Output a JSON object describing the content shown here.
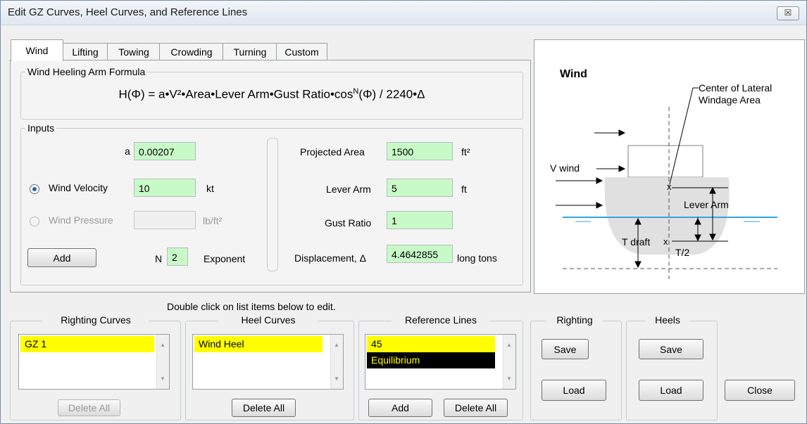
{
  "window": {
    "title": "Edit GZ Curves, Heel Curves, and Reference Lines",
    "close_glyph": "☒"
  },
  "tabs": [
    {
      "label": "Wind",
      "active": true
    },
    {
      "label": "Lifting"
    },
    {
      "label": "Towing"
    },
    {
      "label": "Crowding"
    },
    {
      "label": "Turning"
    },
    {
      "label": "Custom"
    }
  ],
  "formula_group": {
    "legend": "Wind Heeling Arm Formula",
    "text": "H(Φ) = a•V²•Area•Lever Arm•Gust Ratio•cos",
    "superscript": "N",
    "text_end": "(Φ) / 2240•Δ"
  },
  "inputs": {
    "legend": "Inputs",
    "a_label": "a",
    "a_value": "0.00207",
    "wind_velocity_label": "Wind Velocity",
    "wind_velocity_value": "10",
    "wind_velocity_unit": "kt",
    "wind_velocity_selected": true,
    "wind_pressure_label": "Wind Pressure",
    "wind_pressure_value": "",
    "wind_pressure_unit": "lb/ft²",
    "add_label": "Add",
    "n_label": "N",
    "n_value": "2",
    "exponent_label": "Exponent",
    "projected_area_label": "Projected Area",
    "projected_area_value": "1500",
    "projected_area_unit": "ft²",
    "lever_arm_label": "Lever Arm",
    "lever_arm_value": "5",
    "lever_arm_unit": "ft",
    "gust_ratio_label": "Gust Ratio",
    "gust_ratio_value": "1",
    "displacement_label": "Displacement, Δ",
    "displacement_value": "4.4642855",
    "displacement_unit": "long tons"
  },
  "diagram": {
    "title": "Wind",
    "center_label_1": "Center of Lateral",
    "center_label_2": "Windage Area",
    "v_wind_label": "V wind",
    "lever_arm_label": "Lever Arm",
    "t_draft_label": "T draft",
    "t_half_label": "T/2",
    "water_color": "#33a6e8"
  },
  "hint": "Double click on list items below to edit.",
  "righting_curves": {
    "title": "Righting Curves",
    "items": [
      "GZ 1"
    ],
    "delete_all": "Delete All"
  },
  "heel_curves": {
    "title": "Heel Curves",
    "items": [
      "Wind Heel"
    ],
    "delete_all": "Delete All"
  },
  "reference_lines": {
    "title": "Reference Lines",
    "items": [
      "45",
      "Equilibrium"
    ],
    "add": "Add",
    "delete_all": "Delete All"
  },
  "righting": {
    "title": "Righting",
    "save": "Save",
    "load": "Load"
  },
  "heels": {
    "title": "Heels",
    "save": "Save",
    "load": "Load"
  },
  "close_label": "Close",
  "colors": {
    "highlight": "#ffff00",
    "selected_bg": "#000000",
    "selected_fg": "#ffff00",
    "field_green": "#c8fac8"
  }
}
